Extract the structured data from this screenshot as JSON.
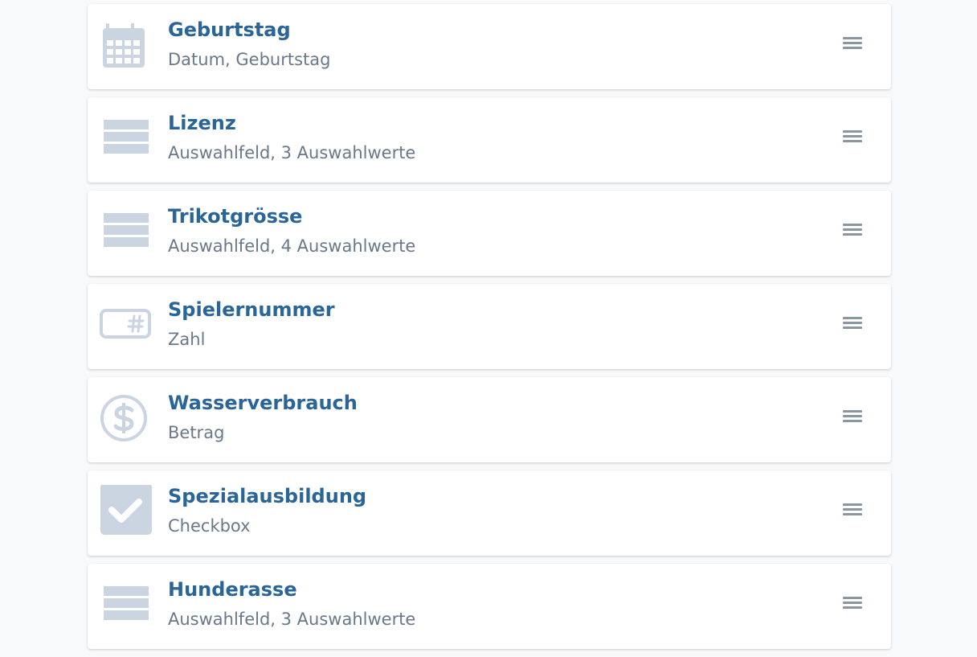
{
  "colors": {
    "title": "#2a6599",
    "subtitle": "#69788a",
    "icon": "#cbd4e1",
    "handle": "#8b96a3",
    "background": "#f7f9fb"
  },
  "fields": [
    {
      "title": "Geburtstag",
      "subtitle": "Datum, Geburtstag",
      "icon": "calendar-icon"
    },
    {
      "title": "Lizenz",
      "subtitle": "Auswahlfeld, 3 Auswahlwerte",
      "icon": "list-icon"
    },
    {
      "title": "Trikotgrösse",
      "subtitle": "Auswahlfeld, 4 Auswahlwerte",
      "icon": "list-icon"
    },
    {
      "title": "Spielernummer",
      "subtitle": "Zahl",
      "icon": "number-field-icon"
    },
    {
      "title": "Wasserverbrauch",
      "subtitle": "Betrag",
      "icon": "dollar-icon"
    },
    {
      "title": "Spezialausbildung",
      "subtitle": "Checkbox",
      "icon": "checkbox-icon"
    },
    {
      "title": "Hunderasse",
      "subtitle": "Auswahlfeld, 3 Auswahlwerte",
      "icon": "list-icon"
    }
  ]
}
